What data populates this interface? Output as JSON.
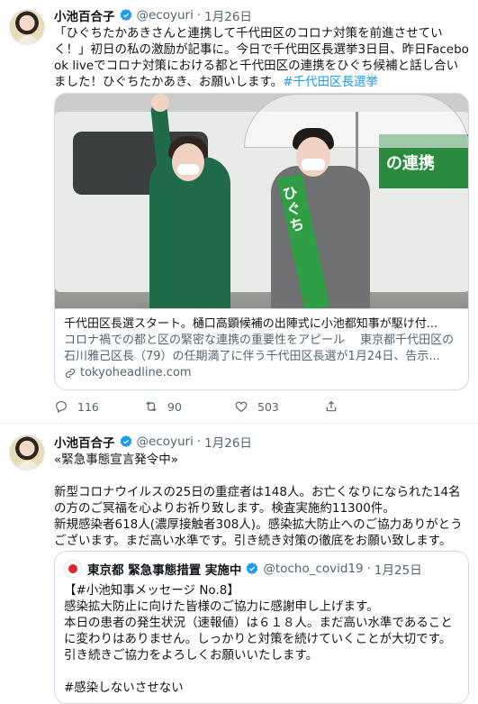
{
  "colors": {
    "link": "#1d9bf0",
    "verified": "#1d9bf0",
    "secondary_text": "#536471",
    "border": "#cfd9de",
    "sign_green": "#2a8a3e"
  },
  "tweet1": {
    "author_name": "小池百合子",
    "handle": "@ecoyuri",
    "separator": "·",
    "date": "1月26日",
    "text": "「ひぐちたかあきさんと連携して千代田区のコロナ対策を前進させていく！」初日の私の激励が記事に。今日で千代田区長選挙3日目、昨日Facebook liveでコロナ対策における都と千代田区の連携をひぐち候補と話し合いました！ひぐちたかあき、お願いします。",
    "hashtag": "#千代田区長選挙",
    "photo": {
      "sign_text": "の連携",
      "sash_text": "ひぐち"
    },
    "card": {
      "title": "千代田区長選スタート。樋口高顕候補の出陣式に小池都知事が駆け付...",
      "description": "コロナ禍での都と区の緊密な連携の重要性をアピール　 東京都千代田区の石川雅己区長（79）の任期満了に伴う千代田区長選が1月24日、告示...",
      "domain": "tokyoheadline.com",
      "link_icon": "link-icon"
    },
    "actions": {
      "replies": "116",
      "retweets": "90",
      "likes": "503"
    }
  },
  "tweet2": {
    "author_name": "小池百合子",
    "handle": "@ecoyuri",
    "separator": "·",
    "date": "1月26日",
    "text": "«緊急事態宣言発令中»\n\n新型コロナウイルスの25日の重症者は148人。お亡くなりになられた14名の方のご冥福を心よりお祈り致します。検査実施約11300件。\n新規感染者618人(濃厚接触者308人)。感染拡大防止へのご協力ありがとうございます。まだ高い水準です。引き続き対策の徹底をお願い致します。",
    "quote": {
      "author_name": "東京都 緊急事態措置 実施中",
      "handle": "@tocho_covid19",
      "separator": "·",
      "date": "1月25日",
      "text": "【#小池知事メッセージ No.8】\n感染拡大防止に向けた皆様のご協力に感謝申し上げます。\n本日の患者の発生状況（速報値）は６１８人。まだ高い水準であることに変わりはありません。しっかりと対策を続けていくことが大切です。引き続きご協力をよろしくお願いいたします。\n\n#感染しないさせない"
    }
  }
}
